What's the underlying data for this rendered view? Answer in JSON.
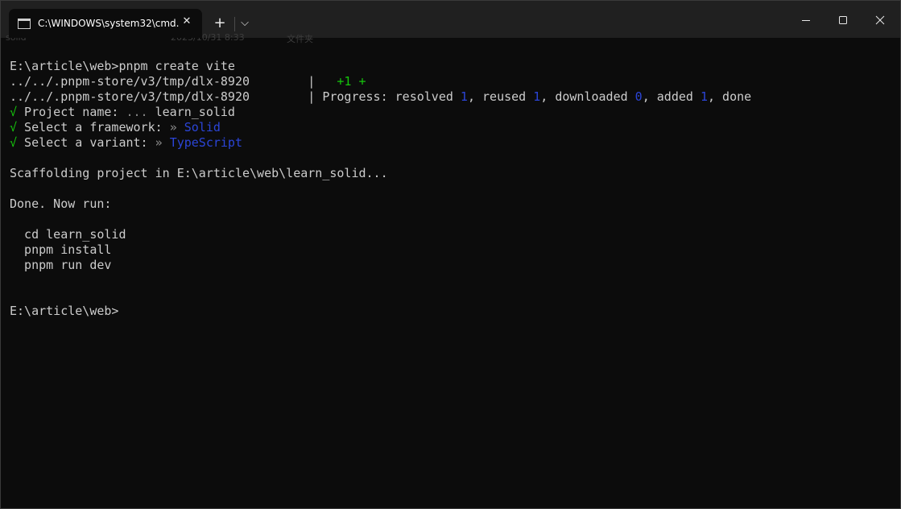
{
  "window": {
    "tab_title": "C:\\WINDOWS\\system32\\cmd.",
    "new_tab_symbol": "+",
    "dropdown_symbol": "⌵",
    "close_symbol": "✕"
  },
  "background_ghost": {
    "name": "solid",
    "date": "2023/10/31 8:33",
    "type": "文件夹"
  },
  "terminal": {
    "line1": "E:\\article\\web>pnpm create vite",
    "line2_path": "../../.pnpm-store/v3/tmp/dlx-8920",
    "line2_sep": "        |   ",
    "line2_added": "+1 +",
    "line3_path": "../../.pnpm-store/v3/tmp/dlx-8920",
    "line3_sep": "        | ",
    "progress_label": "Progress: resolved ",
    "resolved": "1",
    "reused_label": ", reused ",
    "reused": "1",
    "downloaded_label": ", downloaded ",
    "downloaded": "0",
    "added_label": ", added ",
    "added": "1",
    "done_label": ", done",
    "check": "√",
    "q1_label": " Project name: ",
    "q1_sep": "... ",
    "q1_value": "learn_solid",
    "q2_label": " Select a framework: ",
    "q2_sep": "» ",
    "q2_value": "Solid",
    "q3_label": " Select a variant: ",
    "q3_sep": "» ",
    "q3_value": "TypeScript",
    "scaffolding": "Scaffolding project in E:\\article\\web\\learn_solid...",
    "done_now_run": "Done. Now run:",
    "cmd1": "  cd learn_solid",
    "cmd2": "  pnpm install",
    "cmd3": "  pnpm run dev",
    "prompt": "E:\\article\\web>"
  },
  "colors": {
    "background": "#0c0c0c",
    "text": "#cccccc",
    "green": "#16c60c",
    "blue": "#2b45d8"
  }
}
